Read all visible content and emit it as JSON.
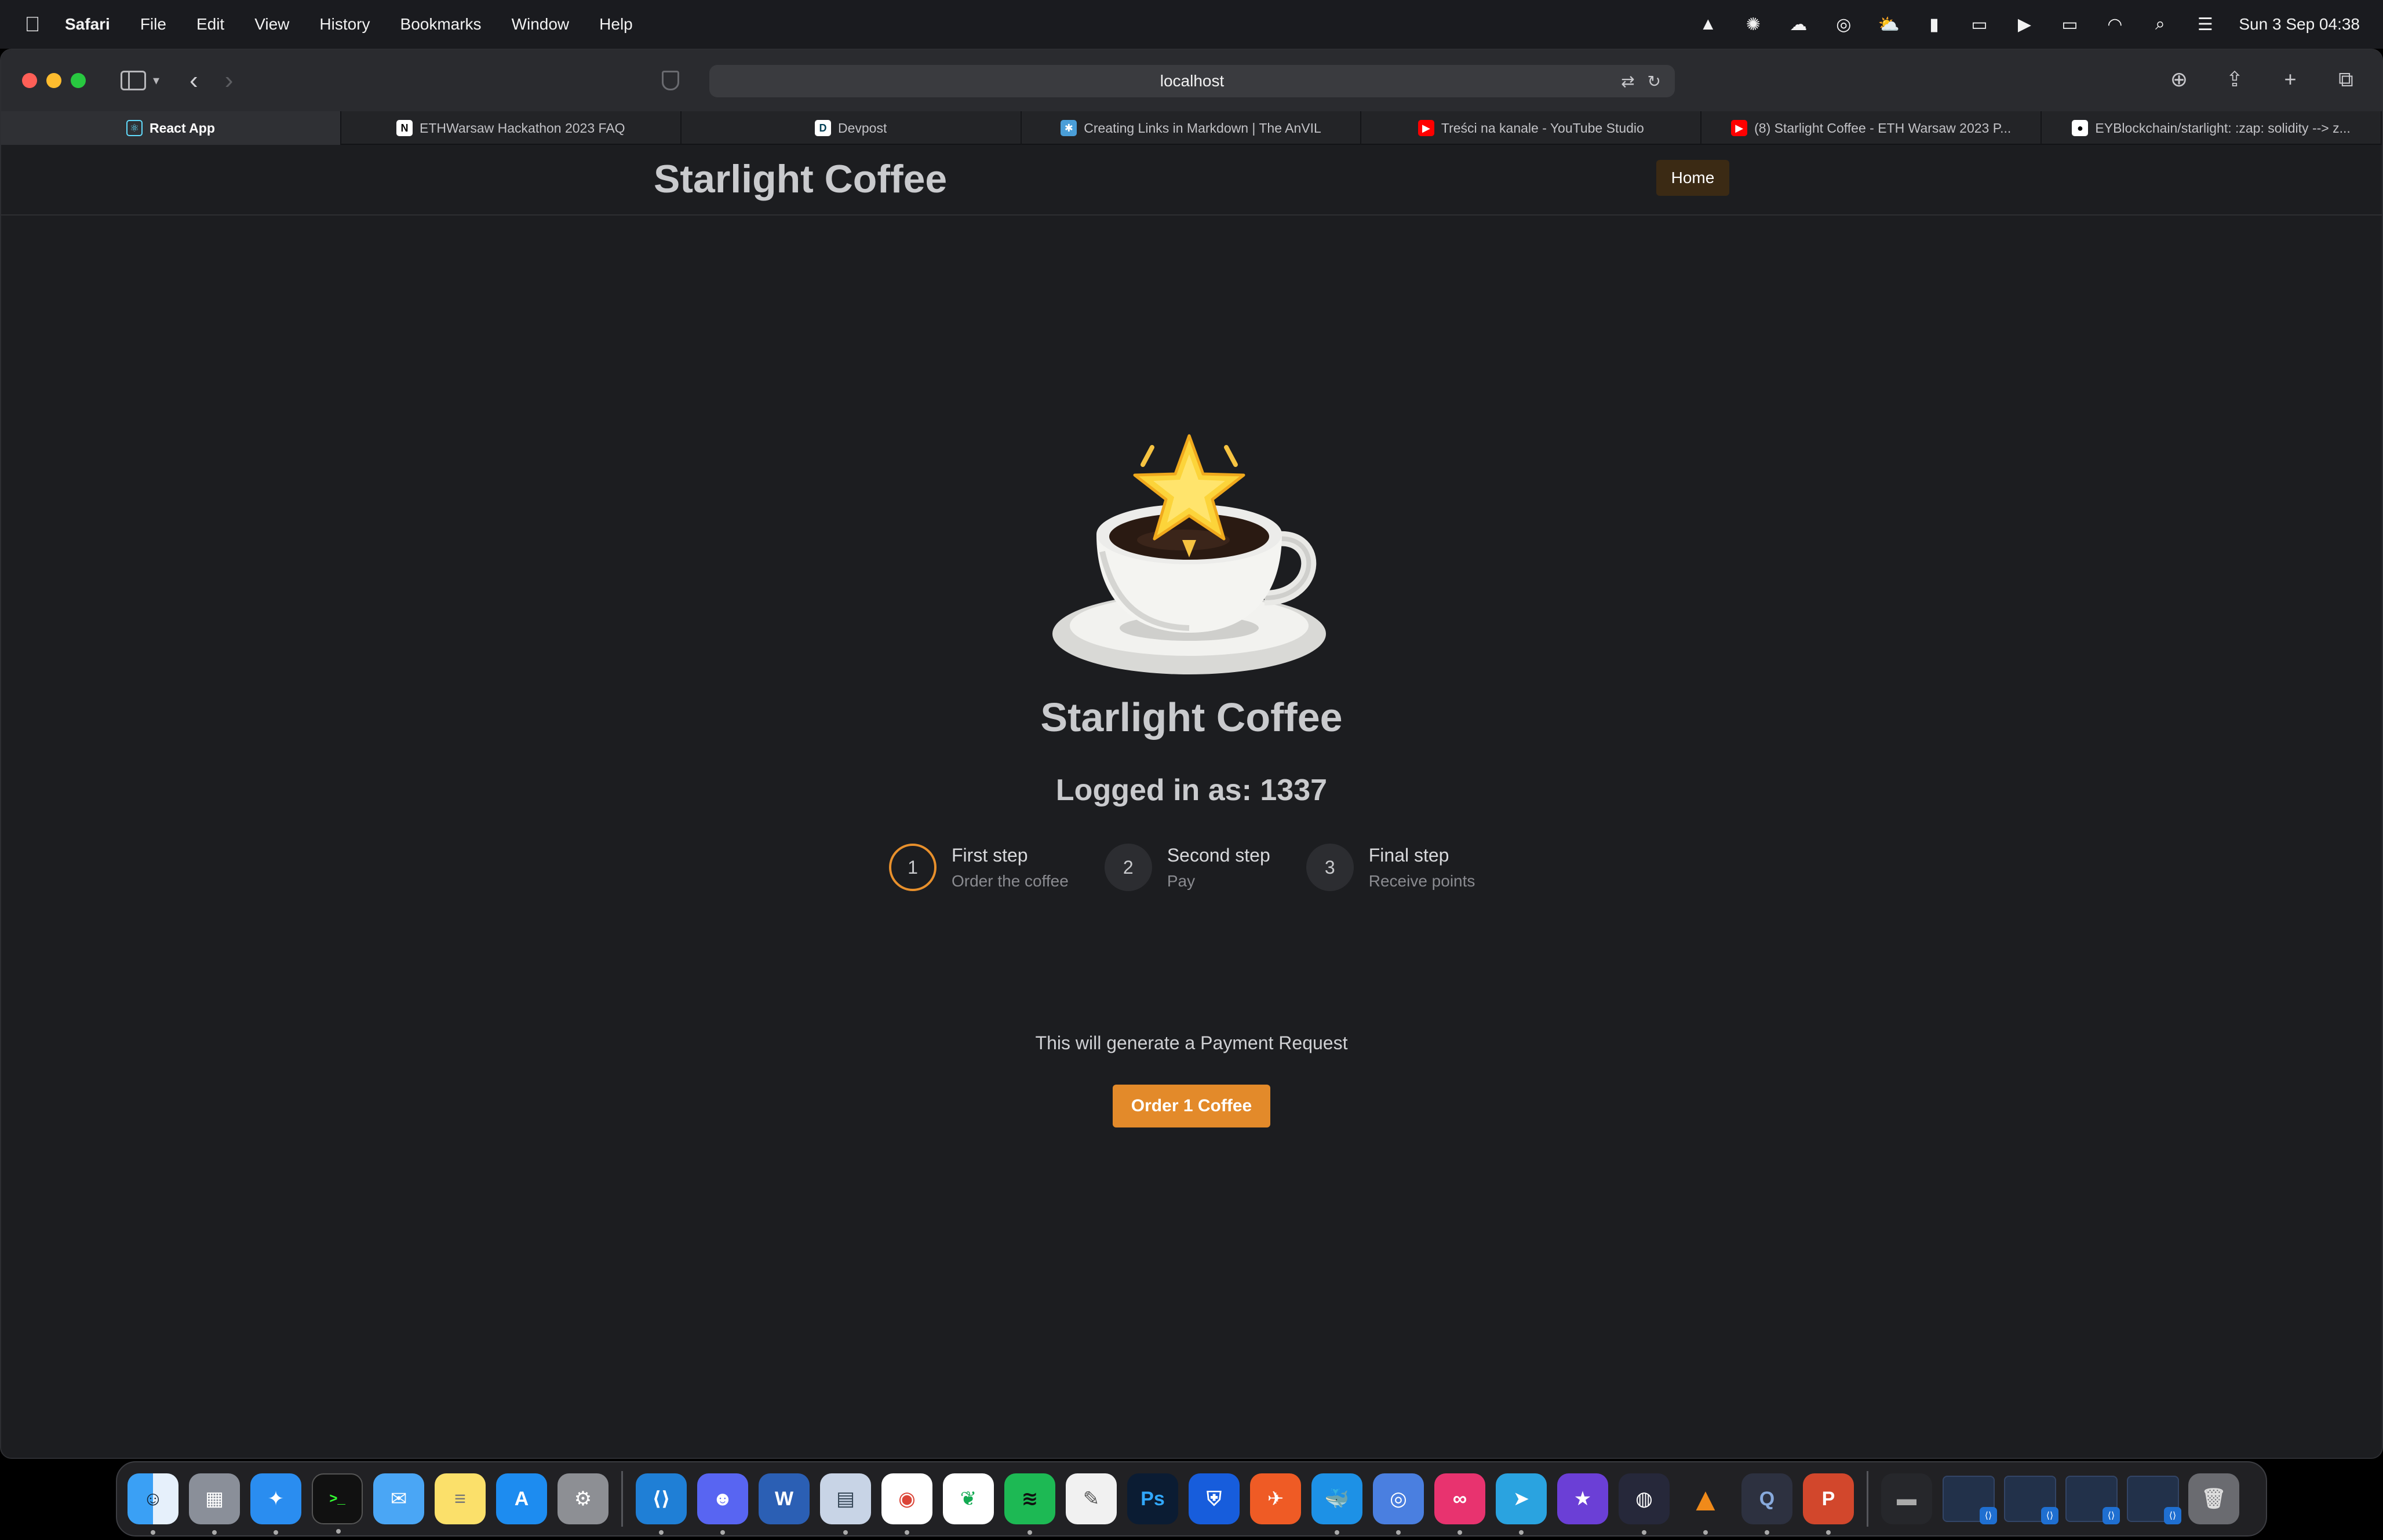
{
  "menubar": {
    "app_name": "Safari",
    "items": [
      "File",
      "Edit",
      "View",
      "History",
      "Bookmarks",
      "Window",
      "Help"
    ],
    "clock": "Sun 3 Sep  04:38"
  },
  "browser": {
    "url": "localhost",
    "tabs": [
      {
        "label": "React App",
        "icon": "react-icon"
      },
      {
        "label": "ETHWarsaw Hackathon 2023 FAQ",
        "icon": "notion-icon"
      },
      {
        "label": "Devpost",
        "icon": "devpost-icon"
      },
      {
        "label": "Creating Links in Markdown | The AnVIL",
        "icon": "anvil-icon"
      },
      {
        "label": "Treści na kanale - YouTube Studio",
        "icon": "youtube-icon"
      },
      {
        "label": "(8) Starlight Coffee - ETH Warsaw 2023 P...",
        "icon": "youtube-icon"
      },
      {
        "label": "EYBlockchain/starlight: :zap: solidity --> z...",
        "icon": "github-icon"
      }
    ]
  },
  "site": {
    "title": "Starlight Coffee",
    "nav_home": "Home",
    "hero_title": "Starlight Coffee",
    "logged_in": "Logged in as: 1337",
    "steps": [
      {
        "number": "1",
        "title": "First step",
        "desc": "Order the coffee",
        "active": true
      },
      {
        "number": "2",
        "title": "Second step",
        "desc": "Pay",
        "active": false
      },
      {
        "number": "3",
        "title": "Final step",
        "desc": "Receive points",
        "active": false
      }
    ],
    "info": "This will generate a Payment Request",
    "order_button": "Order 1 Coffee",
    "accent_color": "#e38a2a"
  },
  "dock": {
    "apps": [
      "finder-icon",
      "launchpad-icon",
      "safari-icon",
      "terminal-icon",
      "mail-icon",
      "notes-icon",
      "app-store-icon",
      "system-settings-icon",
      "vscode-icon",
      "discord-icon",
      "word-icon",
      "preview-icon",
      "chrome-icon",
      "mongodb-icon",
      "spotify-icon",
      "script-editor-icon",
      "photoshop-icon",
      "bitwarden-icon",
      "postman-icon",
      "docker-icon",
      "chrome-alt-icon",
      "creative-cloud-icon",
      "telegram-icon",
      "imovie-icon",
      "obs-icon",
      "vlc-icon",
      "quicktime-icon",
      "powerpoint-icon"
    ]
  }
}
